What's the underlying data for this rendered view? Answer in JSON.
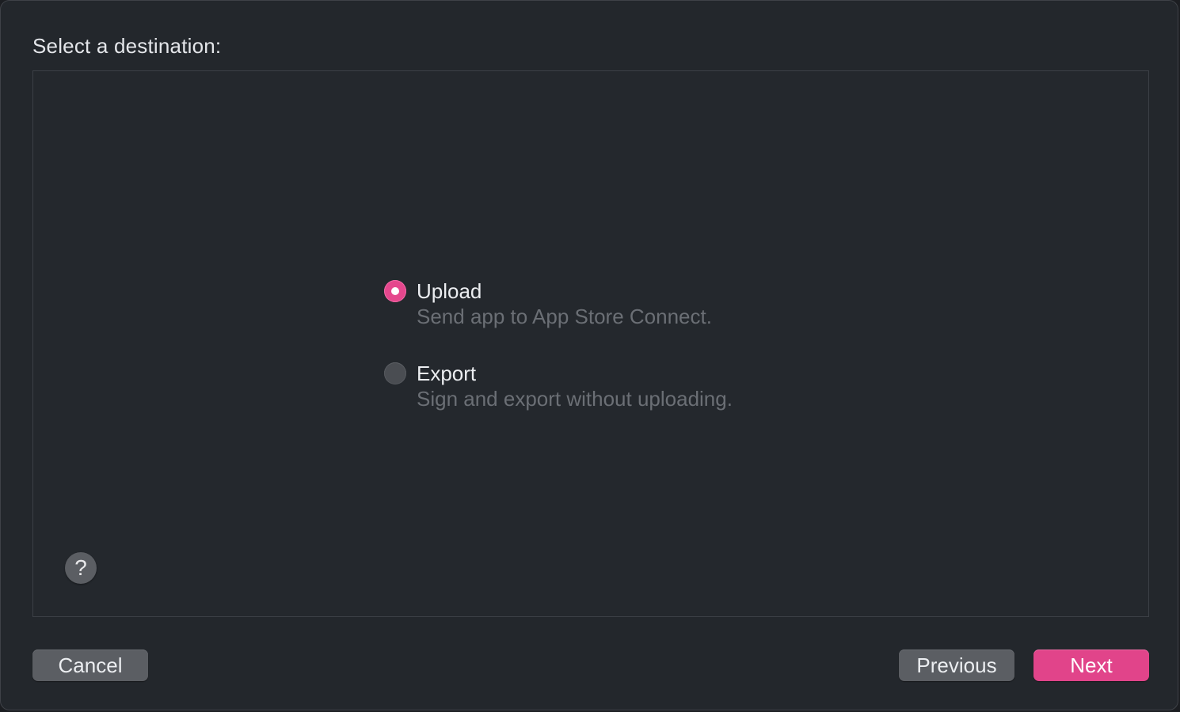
{
  "dialog": {
    "heading": "Select a destination:",
    "accent_color": "#e5478d"
  },
  "options": [
    {
      "title": "Upload",
      "description": "Send app to App Store Connect.",
      "selected": true
    },
    {
      "title": "Export",
      "description": "Sign and export without uploading.",
      "selected": false
    }
  ],
  "help": {
    "label": "?",
    "icon": "help-icon"
  },
  "buttons": {
    "cancel_label": "Cancel",
    "previous_label": "Previous",
    "next_label": "Next"
  }
}
